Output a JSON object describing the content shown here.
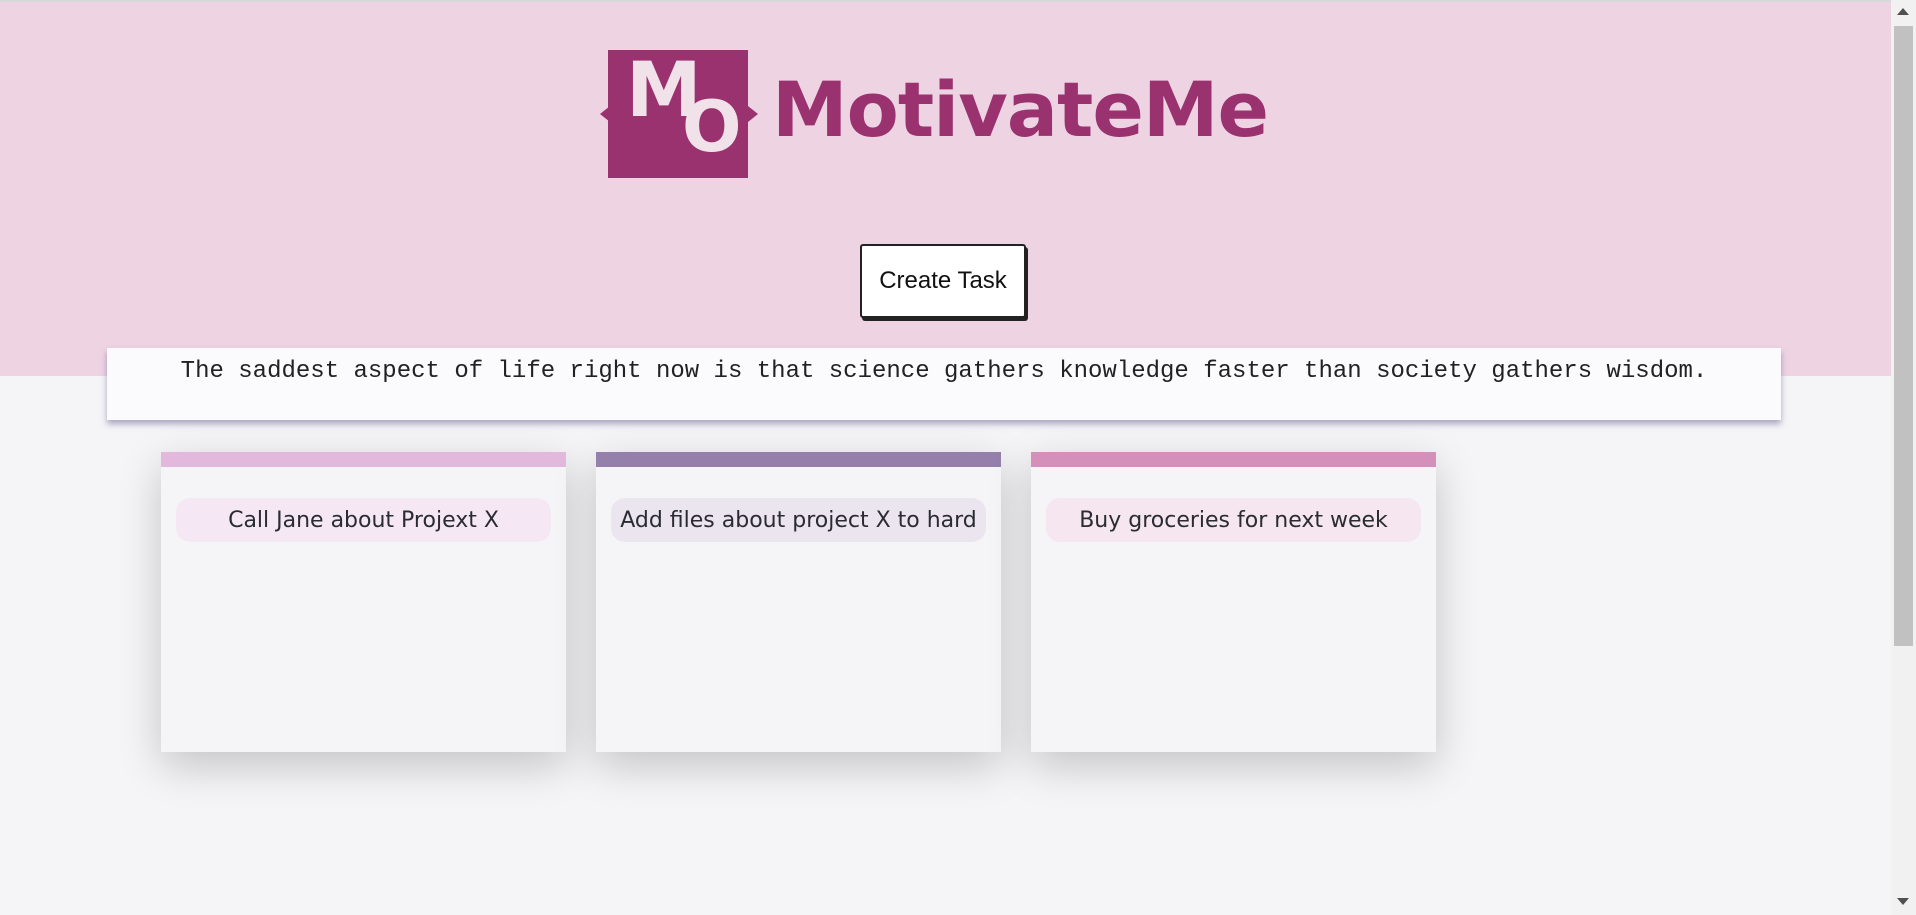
{
  "app": {
    "logo_monogram_m": "M",
    "logo_monogram_o": "O",
    "logo_text": "MotivateMe",
    "brand_color": "#9b3270",
    "header_bg": "#eed3e3"
  },
  "toolbar": {
    "create_task_label": "Create Task"
  },
  "quote": {
    "text": "The saddest aspect of life right now is that science gathers knowledge faster than society gathers wisdom."
  },
  "tasks": [
    {
      "title": "Call Jane about Projext X",
      "stripe_color": "#e2b9dd",
      "pill_color": "#f5e8f4"
    },
    {
      "title": "Add files about project X to hard",
      "stripe_color": "#9580ab",
      "pill_color": "#ebe5ef"
    },
    {
      "title": "Buy groceries for next week",
      "stripe_color": "#d58fbb",
      "pill_color": "#f5e6ef"
    }
  ],
  "icons": {
    "scroll_up": "scroll-up-arrow-icon",
    "scroll_down": "scroll-down-arrow-icon"
  }
}
